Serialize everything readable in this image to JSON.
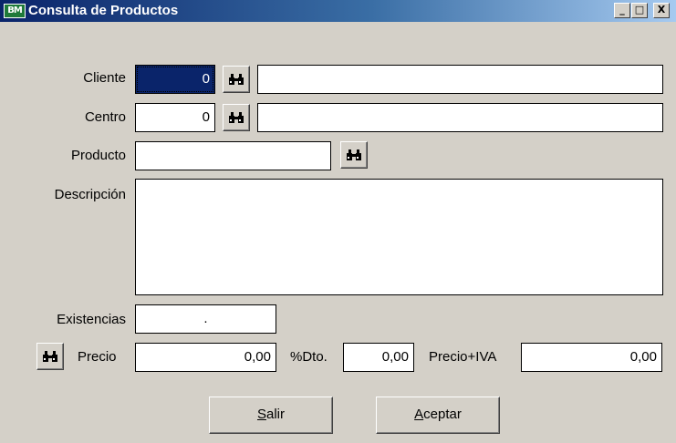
{
  "window": {
    "app_icon": "BM",
    "title": "Consulta de Productos",
    "minimize_label": "_",
    "maximize_label": "□",
    "close_label": "X"
  },
  "form": {
    "cliente": {
      "label": "Cliente",
      "code": "0",
      "name": ""
    },
    "centro": {
      "label": "Centro",
      "code": "0",
      "name": ""
    },
    "producto": {
      "label": "Producto",
      "code": ""
    },
    "descripcion": {
      "label": "Descripción",
      "text": ""
    },
    "existencias": {
      "label": "Existencias",
      "value": "."
    },
    "precio": {
      "label": "Precio",
      "value": "0,00"
    },
    "dto": {
      "label": "%Dto.",
      "value": "0,00"
    },
    "precio_iva": {
      "label": "Precio+IVA",
      "value": "0,00"
    }
  },
  "buttons": {
    "salir": {
      "mnemonic": "S",
      "rest": "alir"
    },
    "aceptar": {
      "mnemonic": "A",
      "rest": "ceptar"
    }
  },
  "icons": {
    "search": "binoculars-icon"
  },
  "colors": {
    "titlebar_start": "#0a246a",
    "titlebar_end": "#a6caf0",
    "face": "#d4d0c8",
    "selection": "#0a246a"
  }
}
